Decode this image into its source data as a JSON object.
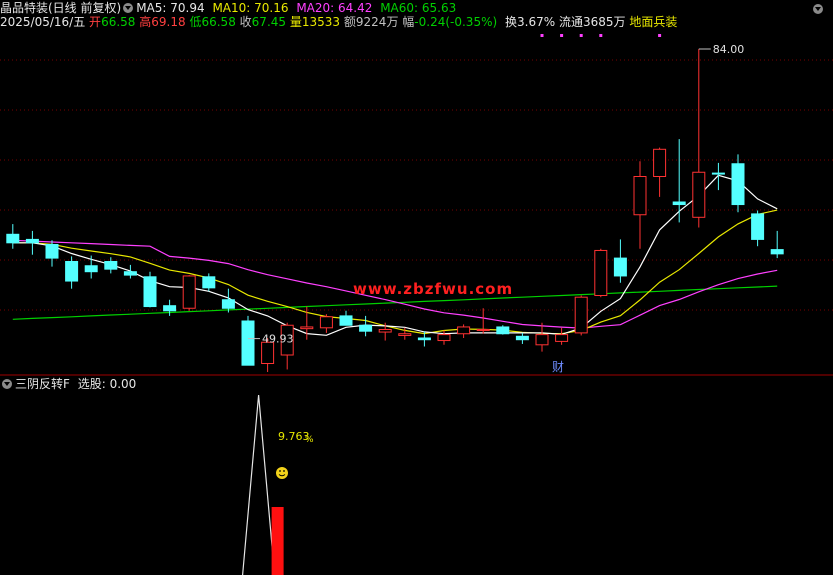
{
  "header": {
    "stock_name": "晶品特装(日线 前复权)",
    "ma5_label": "MA5: 70.94",
    "ma10_label": "MA10: 70.16",
    "ma20_label": "MA20: 64.42",
    "ma60_label": "MA60: 65.63",
    "date": "2025/05/16/五",
    "open_label": "开",
    "open_value": "66.58",
    "high_label": "高",
    "high_value": "69.18",
    "low_label": "低",
    "low_value": "66.58",
    "close_label": "收",
    "close_value": "67.45",
    "volume_label": "量",
    "volume_value": "13533",
    "amount_label": "额",
    "amount_value": "9224万",
    "change_label": "幅",
    "change_value": "-0.24(-0.35%)",
    "turnover": "换3.67%",
    "float_shares": "流通3685万",
    "sector": "地面兵装"
  },
  "indicator": {
    "name": "三阴反转F",
    "label": "选股: 0.00"
  },
  "colors": {
    "up": "#ff3232",
    "down": "#54ffff",
    "ma5": "#ffffff",
    "ma10": "#e8e800",
    "ma20": "#ff40ff",
    "ma60": "#00d000",
    "grid": "#7a0000",
    "watermark": "#ff2020"
  },
  "chart_data": [
    {
      "type": "candlestick",
      "title": "晶品特装(日线 前复权)",
      "ylim": [
        46,
        86
      ],
      "candles": [
        {
          "o": 62.2,
          "h": 63.4,
          "l": 60.5,
          "c": 61.2
        },
        {
          "o": 61.6,
          "h": 62.6,
          "l": 59.8,
          "c": 61.2
        },
        {
          "o": 61.0,
          "h": 61.5,
          "l": 58.4,
          "c": 59.4
        },
        {
          "o": 59.0,
          "h": 59.6,
          "l": 55.8,
          "c": 56.7
        },
        {
          "o": 58.5,
          "h": 59.7,
          "l": 57.0,
          "c": 57.8
        },
        {
          "o": 59.0,
          "h": 59.5,
          "l": 57.6,
          "c": 58.1
        },
        {
          "o": 57.8,
          "h": 58.6,
          "l": 57.0,
          "c": 57.4
        },
        {
          "o": 57.2,
          "h": 57.8,
          "l": 53.6,
          "c": 53.7
        },
        {
          "o": 53.8,
          "h": 54.5,
          "l": 52.6,
          "c": 53.2
        },
        {
          "o": 53.5,
          "h": 57.4,
          "l": 53.2,
          "c": 57.3
        },
        {
          "o": 57.2,
          "h": 57.6,
          "l": 55.5,
          "c": 55.9
        },
        {
          "o": 54.5,
          "h": 55.8,
          "l": 53.0,
          "c": 53.5
        },
        {
          "o": 52.0,
          "h": 52.6,
          "l": 49.93,
          "c": 46.8
        },
        {
          "o": 47.0,
          "h": 50.0,
          "l": 46.0,
          "c": 49.5
        },
        {
          "o": 48.0,
          "h": 51.8,
          "l": 46.3,
          "c": 51.5
        },
        {
          "o": 51.1,
          "h": 53.7,
          "l": 49.8,
          "c": 51.3
        },
        {
          "o": 51.2,
          "h": 52.8,
          "l": 50.6,
          "c": 52.5
        },
        {
          "o": 52.6,
          "h": 53.2,
          "l": 52.0,
          "c": 51.5
        },
        {
          "o": 51.5,
          "h": 52.6,
          "l": 50.2,
          "c": 50.8
        },
        {
          "o": 50.7,
          "h": 51.8,
          "l": 49.7,
          "c": 51.0
        },
        {
          "o": 50.3,
          "h": 51.2,
          "l": 49.8,
          "c": 50.5
        },
        {
          "o": 50.0,
          "h": 50.8,
          "l": 49.0,
          "c": 49.8
        },
        {
          "o": 49.7,
          "h": 50.9,
          "l": 49.2,
          "c": 50.4
        },
        {
          "o": 50.5,
          "h": 51.6,
          "l": 50.0,
          "c": 51.3
        },
        {
          "o": 51.0,
          "h": 53.5,
          "l": 50.5,
          "c": 51.0
        },
        {
          "o": 51.3,
          "h": 51.5,
          "l": 50.4,
          "c": 50.5
        },
        {
          "o": 50.2,
          "h": 50.6,
          "l": 49.3,
          "c": 49.8
        },
        {
          "o": 49.2,
          "h": 51.8,
          "l": 48.4,
          "c": 50.4
        },
        {
          "o": 49.6,
          "h": 51.2,
          "l": 49.2,
          "c": 50.4
        },
        {
          "o": 50.6,
          "h": 55.0,
          "l": 50.3,
          "c": 54.8
        },
        {
          "o": 55.0,
          "h": 60.5,
          "l": 54.8,
          "c": 60.3
        },
        {
          "o": 59.4,
          "h": 61.6,
          "l": 56.5,
          "c": 57.3
        },
        {
          "o": 64.5,
          "h": 70.8,
          "l": 60.5,
          "c": 69.0
        },
        {
          "o": 69.0,
          "h": 72.4,
          "l": 66.6,
          "c": 72.2
        },
        {
          "o": 66.0,
          "h": 73.4,
          "l": 63.6,
          "c": 65.7
        },
        {
          "o": 64.2,
          "h": 84.0,
          "l": 63.0,
          "c": 69.5
        },
        {
          "o": 69.4,
          "h": 70.6,
          "l": 67.4,
          "c": 69.3
        },
        {
          "o": 70.5,
          "h": 71.6,
          "l": 64.8,
          "c": 65.7
        },
        {
          "o": 64.6,
          "h": 65.0,
          "l": 60.8,
          "c": 61.6
        },
        {
          "o": 60.4,
          "h": 62.6,
          "l": 59.4,
          "c": 59.9
        }
      ],
      "annotations": [
        {
          "text": "84.00",
          "candle": 35,
          "price": 84.0
        },
        {
          "text": "49.93",
          "candle": 12,
          "price": 49.93
        }
      ]
    },
    {
      "type": "line",
      "title": "三阴反转F",
      "series": [
        {
          "name": "选股",
          "values": [
            0,
            0,
            0,
            0,
            0,
            0,
            0,
            0,
            0,
            0,
            0,
            0,
            0,
            1,
            0,
            0,
            0,
            0,
            0,
            0,
            0,
            0,
            0,
            0,
            0,
            0,
            0,
            0,
            0,
            0,
            0,
            0,
            0,
            0,
            0,
            0,
            0,
            0,
            0,
            0
          ]
        }
      ]
    }
  ],
  "markers": {
    "earnings_label": "财",
    "pct_label": "9.763",
    "pct_sign": "%",
    "watermark": "www.zbzfwu.com"
  }
}
